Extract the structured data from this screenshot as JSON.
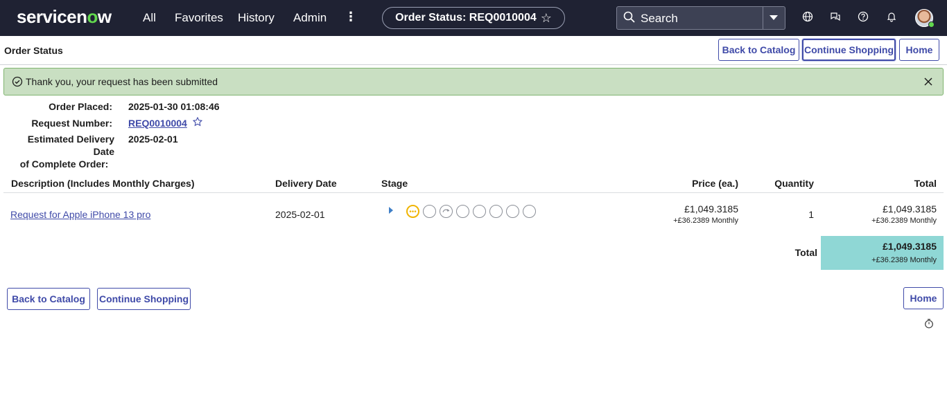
{
  "topnav": {
    "logo": {
      "pre": "servicen",
      "o": "o",
      "post": "w"
    },
    "items": [
      {
        "label": "All"
      },
      {
        "label": "Favorites"
      },
      {
        "label": "History"
      },
      {
        "label": "Admin"
      }
    ],
    "more_label": "⋮",
    "title": "Order Status: REQ0010004",
    "title_star": "☆",
    "search": {
      "placeholder": "Search"
    },
    "icons": [
      "globe-icon",
      "chat-icon",
      "help-icon",
      "bell-icon"
    ]
  },
  "header": {
    "title": "Order Status",
    "buttons": {
      "back_to_catalog": "Back to Catalog",
      "continue_shopping": "Continue Shopping",
      "home": "Home"
    }
  },
  "alert": {
    "message": "Thank you, your request has been submitted"
  },
  "order": {
    "placed_label": "Order Placed:",
    "placed_value": "2025-01-30 01:08:46",
    "request_label": "Request Number:",
    "request_value": "REQ0010004",
    "delivery_label_1": "Estimated Delivery Date",
    "delivery_label_2": "of Complete Order:",
    "delivery_value": "2025-02-01"
  },
  "table": {
    "headers": {
      "description": "Description (Includes Monthly Charges)",
      "delivery_date": "Delivery Date",
      "stage": "Stage",
      "price": "Price (ea.)",
      "quantity": "Quantity",
      "total": "Total"
    },
    "rows": [
      {
        "description": "Request for Apple iPhone 13 pro",
        "delivery_date": "2025-02-01",
        "price": "£1,049.3185",
        "price_monthly": "+£36.2389 Monthly",
        "quantity": "1",
        "total": "£1,049.3185",
        "total_monthly": "+£36.2389 Monthly"
      }
    ],
    "grand_total_label": "Total",
    "grand_total": "£1,049.3185",
    "grand_total_monthly": "+£36.2389 Monthly"
  },
  "footer": {
    "back_to_catalog": "Back to Catalog",
    "continue_shopping": "Continue Shopping",
    "home": "Home"
  },
  "colors": {
    "nav_bg": "#1f2233",
    "accent": "#3f4aa8",
    "alert_bg": "#c9dfc2",
    "total_bg": "#8fd7d5",
    "logo_green": "#62d84e"
  }
}
